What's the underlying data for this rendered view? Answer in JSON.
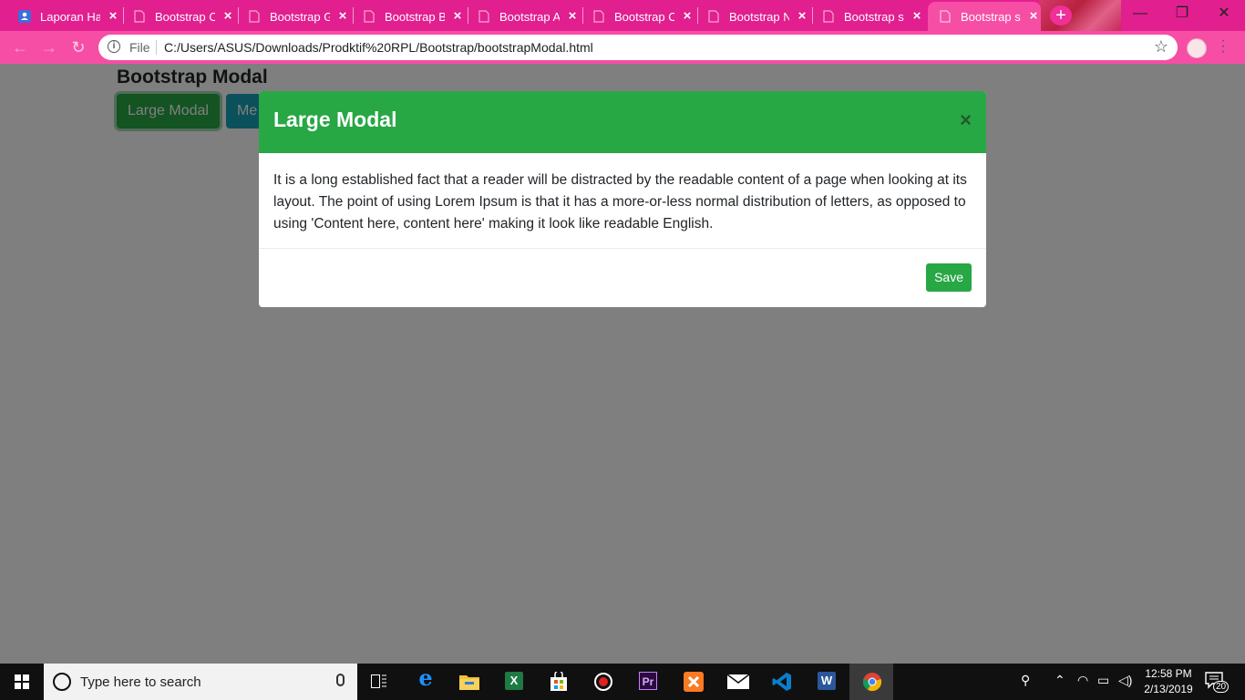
{
  "browser": {
    "tabs": [
      {
        "title": "Laporan Ha",
        "icon": "contact-icon",
        "active": false
      },
      {
        "title": "Bootstrap C",
        "icon": "file-icon",
        "active": false
      },
      {
        "title": "Bootstrap G",
        "icon": "file-icon",
        "active": false
      },
      {
        "title": "Bootstrap B",
        "icon": "file-icon",
        "active": false
      },
      {
        "title": "Bootstrap A",
        "icon": "file-icon",
        "active": false
      },
      {
        "title": "Bootstrap C",
        "icon": "file-icon",
        "active": false
      },
      {
        "title": "Bootstrap N",
        "icon": "file-icon",
        "active": false
      },
      {
        "title": "Bootstrap s",
        "icon": "file-icon",
        "active": false
      },
      {
        "title": "Bootstrap s",
        "icon": "file-icon",
        "active": true
      }
    ],
    "new_tab": "+",
    "window_controls": {
      "minimize": "—",
      "restore": "❐",
      "close": "✕"
    },
    "omnibox": {
      "scheme": "File",
      "url": "C:/Users/ASUS/Downloads/Prodktif%20RPL/Bootstrap/bootstrapModal.html"
    },
    "theme_color": "#e21f8f"
  },
  "page": {
    "heading": "Bootstrap Modal",
    "buttons": {
      "large": "Large Modal",
      "medium": "Me"
    }
  },
  "modal": {
    "title": "Large Modal",
    "close": "×",
    "body": "It is a long established fact that a reader will be distracted by the readable content of a page when looking at its layout. The point of using Lorem Ipsum is that it has a more-or-less normal distribution of letters, as opposed to using 'Content here, content here' making it look like readable English.",
    "save_label": "Save",
    "header_color": "#28a745"
  },
  "taskbar": {
    "search_placeholder": "Type here to search",
    "apps": [
      {
        "name": "task-view-icon",
        "label": "⧉"
      },
      {
        "name": "edge-icon",
        "label": "e"
      },
      {
        "name": "file-explorer-icon",
        "label": ""
      },
      {
        "name": "excel-icon",
        "label": "X"
      },
      {
        "name": "store-icon",
        "label": ""
      },
      {
        "name": "recorder-icon",
        "label": ""
      },
      {
        "name": "premiere-icon",
        "label": "Pr"
      },
      {
        "name": "xampp-icon",
        "label": ""
      },
      {
        "name": "mail-icon",
        "label": ""
      },
      {
        "name": "vscode-icon",
        "label": ""
      },
      {
        "name": "word-icon",
        "label": "W"
      },
      {
        "name": "chrome-icon",
        "label": ""
      }
    ],
    "clock": {
      "time": "12:58 PM",
      "date": "2/13/2019"
    },
    "notification_count": "20"
  }
}
